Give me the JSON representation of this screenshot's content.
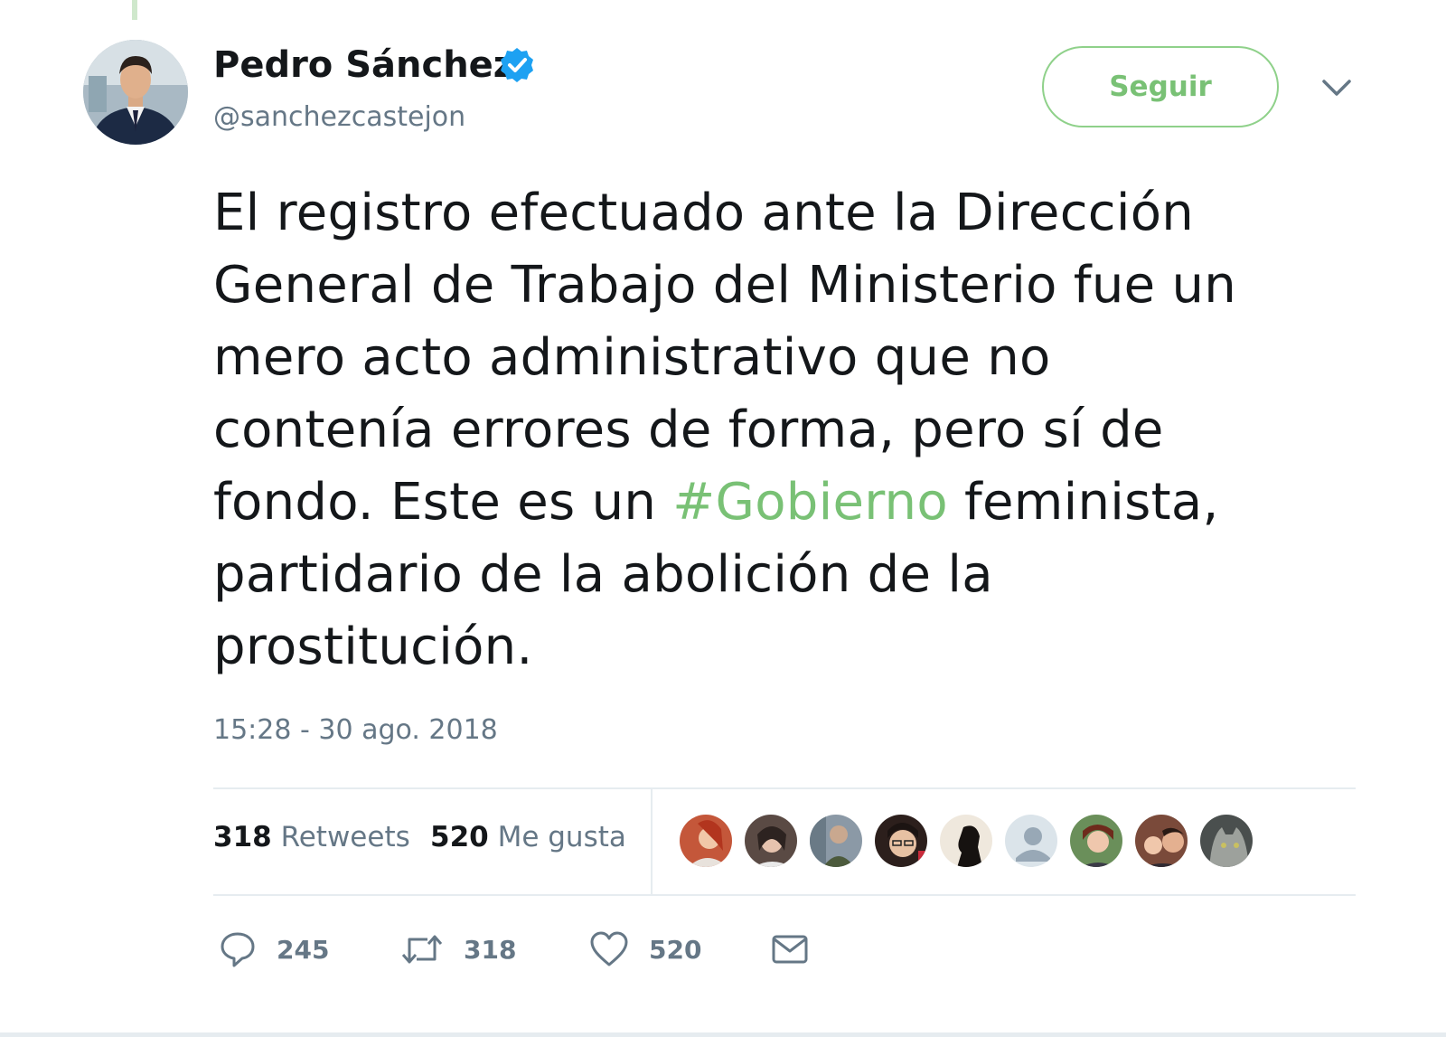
{
  "tweet": {
    "author": {
      "name": "Pedro Sánchez",
      "handle": "@sanchezcastejon",
      "verified": true
    },
    "follow_label": "Seguir",
    "text_lines": [
      "El registro efectuado ante la Dirección",
      "General de Trabajo del Ministerio fue un",
      "mero acto administrativo que no",
      "contenía errores de forma, pero sí de"
    ],
    "text_line5_before": "fondo. Este es un ",
    "hashtag": "#Gobierno",
    "text_line5_after": " feminista,",
    "text_lines_end": [
      "partidario de la abolición de la",
      "prostitución."
    ],
    "timestamp": "15:28 - 30 ago. 2018",
    "stats": {
      "retweets_count": "318",
      "retweets_label": "Retweets",
      "likes_count": "520",
      "likes_label": "Me gusta"
    },
    "actions": {
      "replies": "245",
      "retweets": "318",
      "likes": "520"
    }
  },
  "colors": {
    "accent": "#79c175",
    "verified": "#1da1f2",
    "secondary_text": "#657786",
    "divider": "#e6ecf0"
  },
  "icons": [
    "verified-badge-icon",
    "chevron-down-icon",
    "reply-icon",
    "retweet-icon",
    "heart-icon",
    "envelope-icon"
  ]
}
